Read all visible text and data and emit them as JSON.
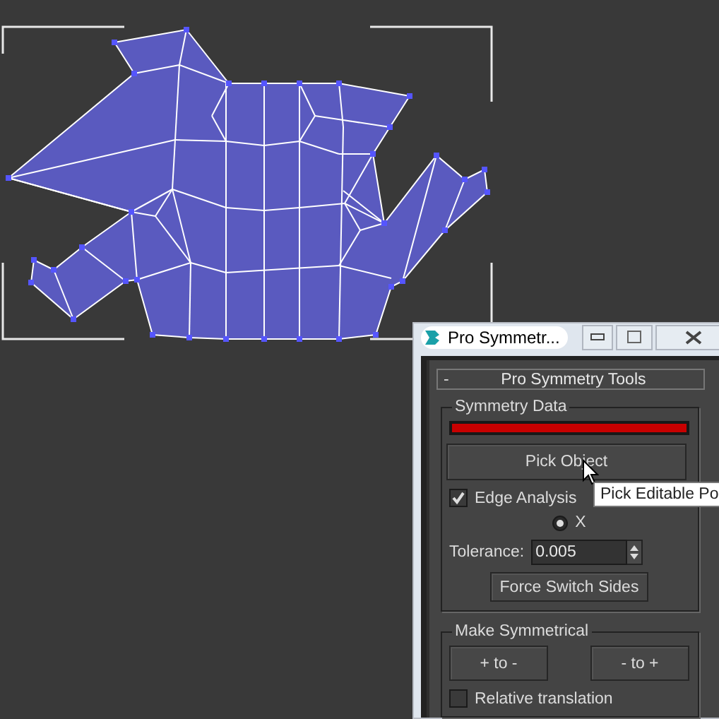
{
  "window": {
    "title": "Pro Symmetr..."
  },
  "rollout": {
    "toggle": "-",
    "title": "Pro Symmetry Tools"
  },
  "symmetry_data": {
    "title": "Symmetry Data",
    "pick_button": "Pick Object",
    "tooltip": "Pick Editable Po",
    "edge_analysis": {
      "label": "Edge Analysis",
      "checked": true
    },
    "axes": [
      {
        "label": "X",
        "selected": true
      }
    ],
    "tolerance": {
      "label": "Tolerance:",
      "value": "0.005"
    },
    "force_button": "Force Switch Sides"
  },
  "make_symmetrical": {
    "title": "Make Symmetrical",
    "buttons": [
      "+ to -",
      "- to +"
    ],
    "relative_translation": {
      "label": "Relative translation",
      "checked": false
    }
  }
}
